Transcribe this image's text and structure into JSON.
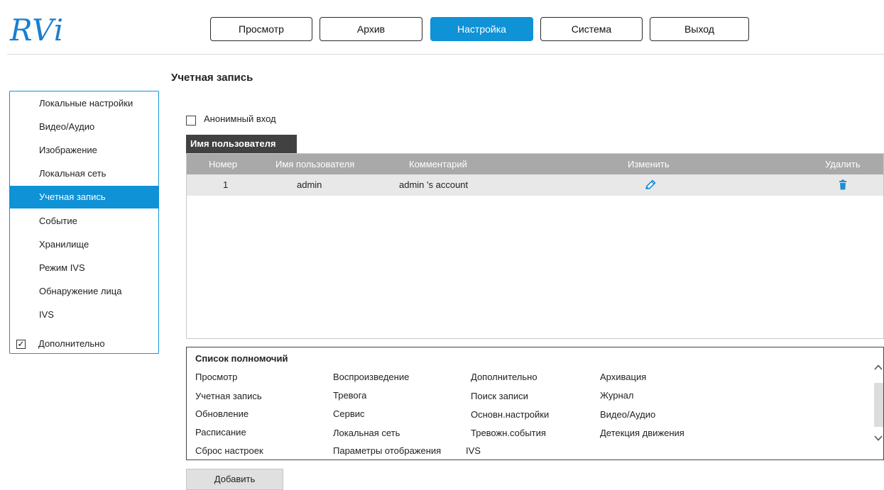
{
  "brand": {
    "logo_text": "RVi",
    "accent_color": "#0f92d6"
  },
  "top_nav": [
    {
      "label": "Просмотр",
      "active": false
    },
    {
      "label": "Архив",
      "active": false
    },
    {
      "label": "Настройка",
      "active": true
    },
    {
      "label": "Система",
      "active": false
    },
    {
      "label": "Выход",
      "active": false
    }
  ],
  "sidebar": {
    "items": [
      {
        "label": "Локальные настройки"
      },
      {
        "label": "Видео/Аудио"
      },
      {
        "label": "Изображение"
      },
      {
        "label": "Локальная сеть"
      },
      {
        "label": "Учетная запись",
        "active": true
      },
      {
        "label": "Событие"
      },
      {
        "label": "Хранилище"
      },
      {
        "label": "Режим IVS"
      },
      {
        "label": "Обнаружение лица"
      },
      {
        "label": "IVS"
      }
    ],
    "advanced_label": "Дополнительно",
    "advanced_checked": true
  },
  "page": {
    "title": "Учетная запись",
    "anonymous_login_label": "Анонимный вход",
    "anonymous_login_checked": false,
    "tab_label": "Имя пользователя"
  },
  "users_table": {
    "headers": [
      "Номер",
      "Имя пользователя",
      "Комментарий",
      "Изменить",
      "Удалить"
    ],
    "rows": [
      {
        "number": "1",
        "username": "admin",
        "comment": "admin 's account",
        "edit_icon": "pencil-icon",
        "delete_icon": "trash-icon"
      }
    ]
  },
  "permissions": {
    "title": "Список полномочий",
    "columns": [
      [
        "Просмотр",
        "Учетная запись",
        "Обновление",
        "Расписание",
        "Сброс настроек"
      ],
      [
        "Воспроизведение",
        "Тревога",
        "Сервис",
        "Локальная сеть",
        "Параметры отображения"
      ],
      [
        "Дополнительно",
        "Поиск записи",
        "Основн.настройки",
        "Тревожн.события",
        "IVS"
      ],
      [
        "Архивация",
        "Журнал",
        "Видео/Аудио",
        "Детекция движения"
      ]
    ]
  },
  "add_button_label": "Добавить"
}
